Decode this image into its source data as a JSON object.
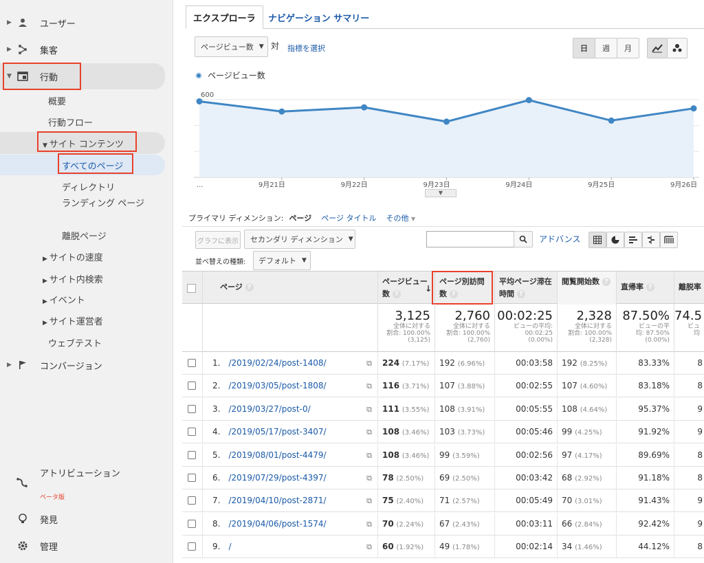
{
  "sidebar": {
    "items": [
      {
        "label": "ユーザー"
      },
      {
        "label": "集客"
      },
      {
        "label": "行動"
      },
      {
        "label": "コンバージョン"
      }
    ],
    "behavior_sub": [
      "概要",
      "行動フロー"
    ],
    "site_content": {
      "label": "サイト コンテンツ",
      "items": [
        "すべてのページ",
        "ディレクトリ",
        "ランディング ページ",
        "離脱ページ"
      ]
    },
    "behavior_more": [
      "サイトの速度",
      "サイト内検索",
      "イベント",
      "サイト運営者",
      "ウェブテスト"
    ],
    "bottom": {
      "attribution": "アトリビューション",
      "beta": "ベータ版",
      "discover": "発見",
      "admin": "管理"
    }
  },
  "tabs": {
    "explorer": "エクスプローラ",
    "nav_summary": "ナビゲーション サマリー"
  },
  "controls": {
    "metric_select": "ページビュー数",
    "vs": "対",
    "select_metric": "指標を選択",
    "day": "日",
    "week": "週",
    "month": "月",
    "legend": "ページビュー数"
  },
  "chart_data": {
    "type": "line",
    "x": [
      "",
      "9月21日",
      "9月22日",
      "9月23日",
      "9月24日",
      "9月25日",
      "9月26日"
    ],
    "series": [
      {
        "name": "ページビュー数",
        "values": [
          586,
          508,
          540,
          430,
          596,
          438,
          532
        ]
      }
    ],
    "yticks": [
      "600",
      "400",
      "200"
    ],
    "first_tick": "...",
    "ylim": [
      0,
      700
    ],
    "grid": true
  },
  "dimension": {
    "primary_label": "プライマリ ディメンション:",
    "page": "ページ",
    "page_title": "ページ タイトル",
    "other": "その他"
  },
  "table_controls": {
    "graph_btn": "グラフに表示",
    "secondary": "セカンダリ ディメンション",
    "advance": "アドバンス",
    "sort_label": "並べ替えの種類:",
    "sort_value": "デフォルト"
  },
  "table": {
    "headers": [
      "ページ",
      "ページビュー数",
      "ページ別訪問数",
      "平均ページ滞在時間",
      "閲覧開始数",
      "直帰率",
      "離脱率"
    ],
    "totals": [
      {
        "big": "3,125",
        "l1": "全体に対する",
        "l2": "割合: 100.00%",
        "l3": "(3,125)"
      },
      {
        "big": "2,760",
        "l1": "全体に対する",
        "l2": "割合: 100.00%",
        "l3": "(2,760)"
      },
      {
        "big": "00:02:25",
        "l1": "ビューの平均:",
        "l2": "00:02:25",
        "l3": "(0.00%)"
      },
      {
        "big": "2,328",
        "l1": "全体に対する",
        "l2": "割合: 100.00%",
        "l3": "(2,328)"
      },
      {
        "big": "87.50%",
        "l1": "ビューの平",
        "l2": "均: 87.50%",
        "l3": "(0.00%)"
      },
      {
        "big": "74.5",
        "l1": "ビュ",
        "l2": "均",
        "l3": ""
      }
    ],
    "rows": [
      {
        "n": "1.",
        "page": "/2019/02/24/post-1408/",
        "pv": "224",
        "pvp": "(7.17%)",
        "uv": "192",
        "uvp": "(6.96%)",
        "time": "00:03:58",
        "ent": "192",
        "entp": "(8.25%)",
        "bounce": "83.33%",
        "exit": "8"
      },
      {
        "n": "2.",
        "page": "/2019/03/05/post-1808/",
        "pv": "116",
        "pvp": "(3.71%)",
        "uv": "107",
        "uvp": "(3.88%)",
        "time": "00:02:55",
        "ent": "107",
        "entp": "(4.60%)",
        "bounce": "83.18%",
        "exit": "8"
      },
      {
        "n": "3.",
        "page": "/2019/03/27/post-0/",
        "pv": "111",
        "pvp": "(3.55%)",
        "uv": "108",
        "uvp": "(3.91%)",
        "time": "00:05:55",
        "ent": "108",
        "entp": "(4.64%)",
        "bounce": "95.37%",
        "exit": "9"
      },
      {
        "n": "4.",
        "page": "/2019/05/17/post-3407/",
        "pv": "108",
        "pvp": "(3.46%)",
        "uv": "103",
        "uvp": "(3.73%)",
        "time": "00:05:46",
        "ent": "99",
        "entp": "(4.25%)",
        "bounce": "91.92%",
        "exit": "9"
      },
      {
        "n": "5.",
        "page": "/2019/08/01/post-4479/",
        "pv": "108",
        "pvp": "(3.46%)",
        "uv": "99",
        "uvp": "(3.59%)",
        "time": "00:02:56",
        "ent": "97",
        "entp": "(4.17%)",
        "bounce": "89.69%",
        "exit": "8"
      },
      {
        "n": "6.",
        "page": "/2019/07/29/post-4397/",
        "pv": "78",
        "pvp": "(2.50%)",
        "uv": "69",
        "uvp": "(2.50%)",
        "time": "00:03:42",
        "ent": "68",
        "entp": "(2.92%)",
        "bounce": "91.18%",
        "exit": "8"
      },
      {
        "n": "7.",
        "page": "/2019/04/10/post-2871/",
        "pv": "75",
        "pvp": "(2.40%)",
        "uv": "71",
        "uvp": "(2.57%)",
        "time": "00:05:49",
        "ent": "70",
        "entp": "(3.01%)",
        "bounce": "91.43%",
        "exit": "9"
      },
      {
        "n": "8.",
        "page": "/2019/04/06/post-1574/",
        "pv": "70",
        "pvp": "(2.24%)",
        "uv": "67",
        "uvp": "(2.43%)",
        "time": "00:03:11",
        "ent": "66",
        "entp": "(2.84%)",
        "bounce": "92.42%",
        "exit": "9"
      },
      {
        "n": "9.",
        "page": "/",
        "pv": "60",
        "pvp": "(1.92%)",
        "uv": "49",
        "uvp": "(1.78%)",
        "time": "00:02:14",
        "ent": "34",
        "entp": "(1.46%)",
        "bounce": "44.12%",
        "exit": "8"
      }
    ]
  },
  "colors": {
    "accent": "#3f86c4",
    "highlight": "#e8412b",
    "link": "#1a5aa8"
  }
}
